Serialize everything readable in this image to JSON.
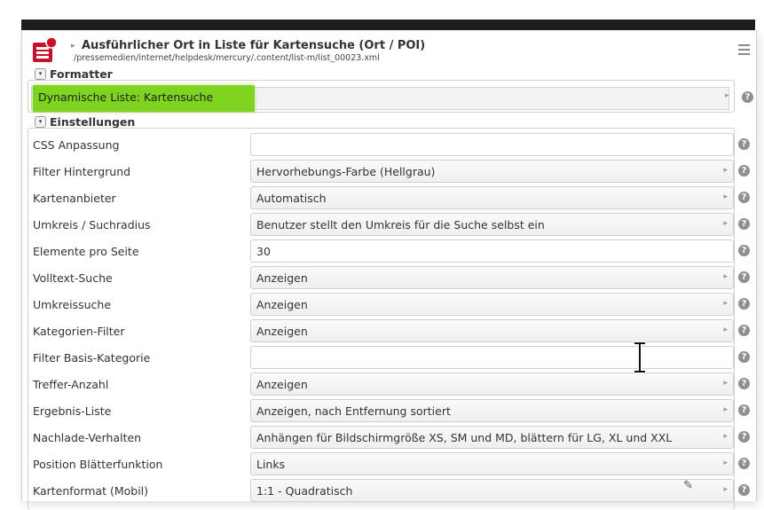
{
  "header": {
    "title": "Ausführlicher Ort in Liste für Kartensuche (Ort / POI)",
    "path": "/pressemedien/internet/helpdesk/mercury/.content/list-m/list_00023.xml"
  },
  "formatter": {
    "label": "Formatter",
    "value": "Dynamische Liste: Kartensuche"
  },
  "settings": {
    "label": "Einstellungen",
    "rows": [
      {
        "label": "CSS Anpassung",
        "value": "",
        "type": "text"
      },
      {
        "label": "Filter Hintergrund",
        "value": "Hervorhebungs-Farbe (Hellgrau)",
        "type": "select"
      },
      {
        "label": "Kartenanbieter",
        "value": "Automatisch",
        "type": "select"
      },
      {
        "label": "Umkreis / Suchradius",
        "value": "Benutzer stellt den Umkreis für die Suche selbst ein",
        "type": "select"
      },
      {
        "label": "Elemente pro Seite",
        "value": "30",
        "type": "text"
      },
      {
        "label": "Volltext-Suche",
        "value": "Anzeigen",
        "type": "select"
      },
      {
        "label": "Umkreissuche",
        "value": "Anzeigen",
        "type": "select"
      },
      {
        "label": "Kategorien-Filter",
        "value": "Anzeigen",
        "type": "select"
      },
      {
        "label": "Filter Basis-Kategorie",
        "value": "",
        "type": "text"
      },
      {
        "label": "Treffer-Anzahl",
        "value": "Anzeigen",
        "type": "select"
      },
      {
        "label": "Ergebnis-Liste",
        "value": "Anzeigen, nach Entfernung sortiert",
        "type": "select"
      },
      {
        "label": "Nachlade-Verhalten",
        "value": "Anhängen für Bildschirmgröße XS, SM und MD, blättern für LG, XL und XXL",
        "type": "select"
      },
      {
        "label": "Position Blätterfunktion",
        "value": "Links",
        "type": "select"
      },
      {
        "label": "Kartenformat (Mobil)",
        "value": "1:1 - Quadratisch",
        "type": "select"
      }
    ]
  },
  "icons": {
    "help": "?",
    "caret": "▸",
    "toggle": "▾"
  }
}
